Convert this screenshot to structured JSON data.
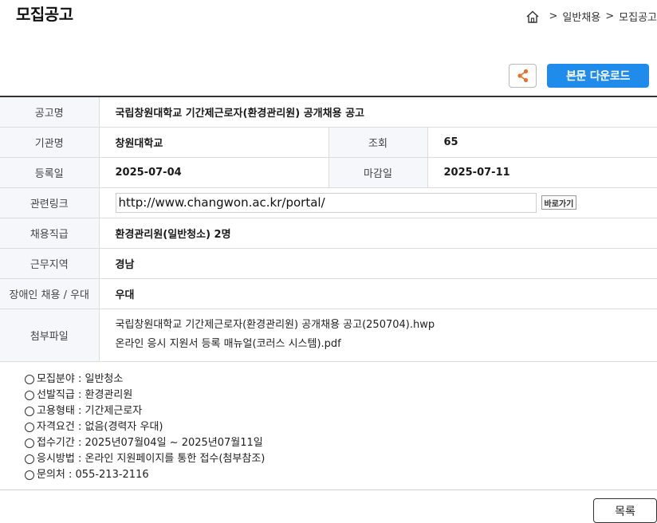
{
  "header": {
    "title": "모집공고",
    "breadcrumb": [
      "일반채용",
      "모집공고"
    ],
    "breadcrumb_separator": ">"
  },
  "toolbar": {
    "share_icon": "share-icon",
    "download_label": "본문 다운로드",
    "accent_color": "#1f8ceb"
  },
  "info": {
    "title_label": "공고명",
    "title_value": "국립창원대학교 기간제근로자(환경관리원) 공개채용 공고",
    "org_label": "기관명",
    "org_value": "창원대학교",
    "views_label": "조회",
    "views_value": "65",
    "reg_label": "등록일",
    "reg_value": "2025-07-04",
    "deadline_label": "마감일",
    "deadline_value": "2025-07-11",
    "link_label": "관련링크",
    "link_value": "http://www.changwon.ac.kr/portal/",
    "go_label": "바로가기",
    "position_label": "채용직급",
    "position_value": "환경관리원(일반청소) 2명",
    "region_label": "근무지역",
    "region_value": "경남",
    "disability_label": "장애인 채용 / 우대",
    "disability_value": "우대",
    "files_label": "첨부파일",
    "files": [
      "국립창원대학교 기간제근로자(환경관리원) 공개채용 공고(250704).hwp",
      "온라인 응시 지원서 등록 매뉴얼(코러스 시스템).pdf"
    ]
  },
  "details": [
    "모집분야 : 일반청소",
    "선발직급 : 환경관리원",
    "고용형태 : 기간제근로자",
    "자격요건 : 없음(경력자 우대)",
    "접수기간 : 2025년07월04일 ~ 2025년07월11일",
    "응시방법 : 온라인 지원페이지를 통한 접수(첨부참조)",
    "문의처 : 055-213-2116"
  ],
  "footer": {
    "list_label": "목록"
  }
}
